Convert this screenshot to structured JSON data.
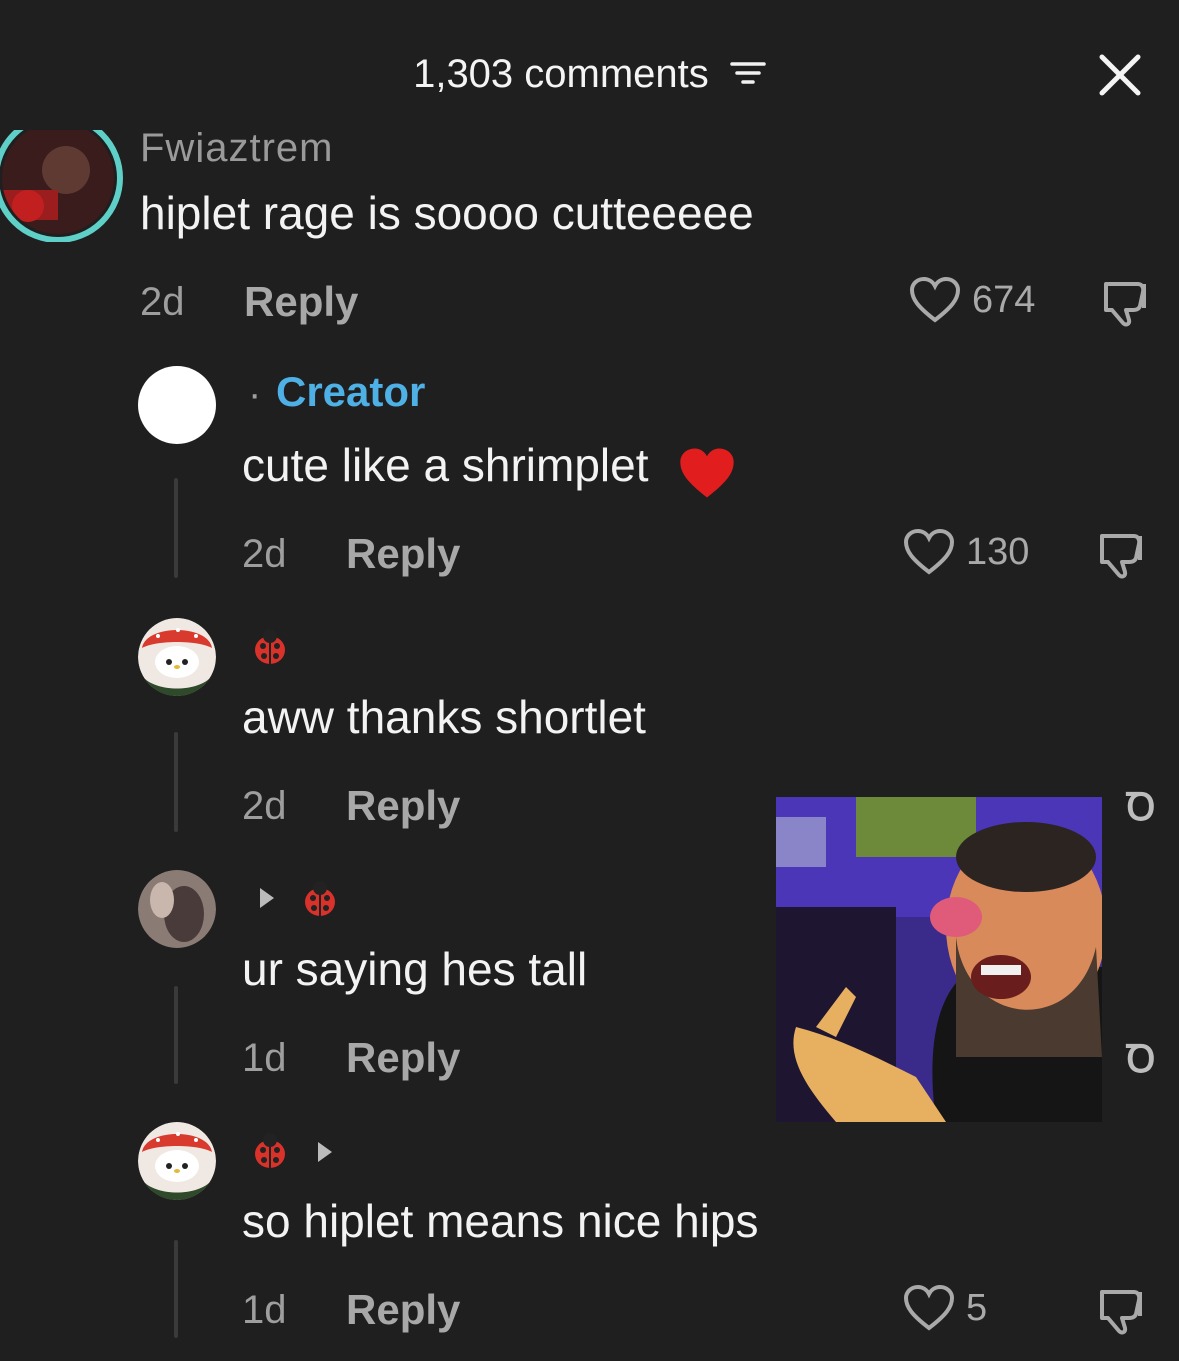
{
  "header": {
    "count_label": "1,303 comments"
  },
  "top_comment": {
    "username": "Fwjaztrem",
    "text": "hiplet rage is soooo cutteeeee",
    "time": "2d",
    "reply_label": "Reply",
    "likes": "674"
  },
  "replies": [
    {
      "badge": "Creator",
      "text": "cute like a shrimplet",
      "emoji": "❤️",
      "time": "2d",
      "reply_label": "Reply",
      "likes": "130"
    },
    {
      "text": "aww thanks shortlet",
      "time": "2d",
      "reply_label": "Reply"
    },
    {
      "text": "ur saying hes tall",
      "time": "1d",
      "reply_label": "Reply"
    },
    {
      "text": "so hiplet means nice hips",
      "time": "1d",
      "reply_label": "Reply",
      "likes": "5"
    }
  ],
  "colors": {
    "background": "#1f1f1f",
    "creator_badge": "#4fb0e6",
    "text": "#f3f3f3",
    "muted": "#9e9e9e"
  }
}
